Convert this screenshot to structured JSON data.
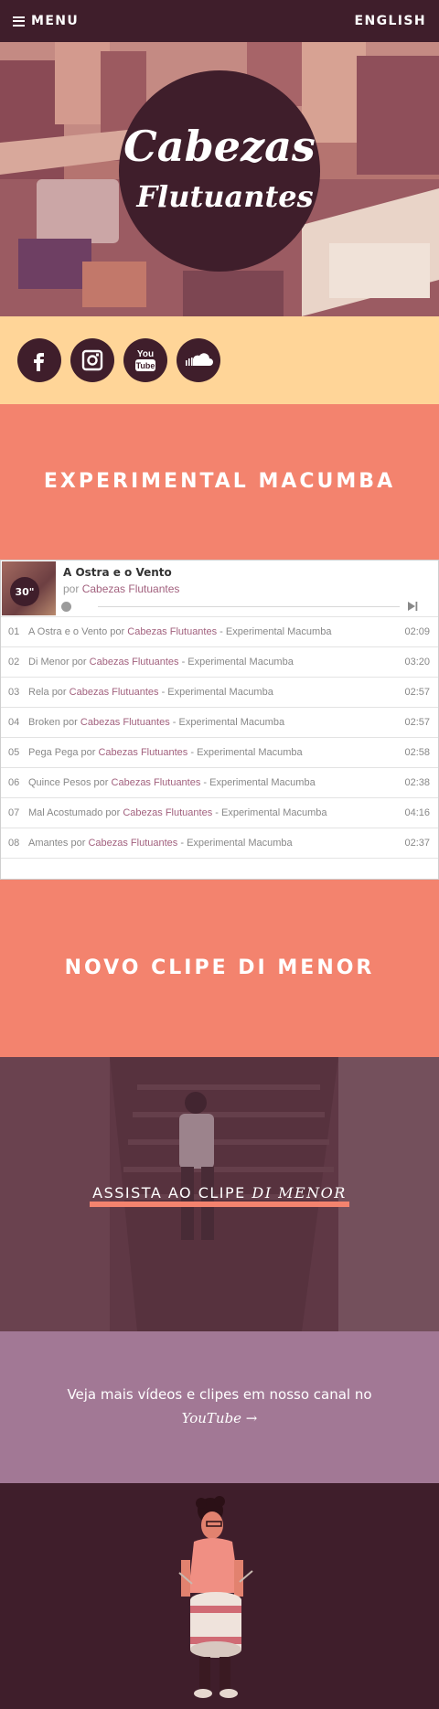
{
  "nav": {
    "menu_label": "MENU",
    "language_label": "ENGLISH"
  },
  "hero": {
    "logo_line1": "Cabezas",
    "logo_line2": "Flutuantes"
  },
  "social": [
    {
      "icon": "facebook-icon"
    },
    {
      "icon": "instagram-icon"
    },
    {
      "icon": "youtube-icon",
      "text": "You Tube"
    },
    {
      "icon": "soundcloud-icon"
    }
  ],
  "album": {
    "title": "EXPERIMENTAL MACUMBA",
    "player": {
      "cover_badge": "30\"",
      "now_title": "A Ostra e o Vento",
      "now_by": "por",
      "now_artist": "Cabezas Flutuantes",
      "tracks": [
        {
          "no": "01",
          "title": "A Ostra e o Vento",
          "by": "por",
          "artist": "Cabezas Flutuantes",
          "album": "- Experimental Macumba",
          "duration": "02:09"
        },
        {
          "no": "02",
          "title": "Di Menor",
          "by": "por",
          "artist": "Cabezas Flutuantes",
          "album": "- Experimental Macumba",
          "duration": "03:20"
        },
        {
          "no": "03",
          "title": "Rela",
          "by": "por",
          "artist": "Cabezas Flutuantes",
          "album": "- Experimental Macumba",
          "duration": "02:57"
        },
        {
          "no": "04",
          "title": "Broken",
          "by": "por",
          "artist": "Cabezas Flutuantes",
          "album": "- Experimental Macumba",
          "duration": "02:57"
        },
        {
          "no": "05",
          "title": "Pega Pega",
          "by": "por",
          "artist": "Cabezas Flutuantes",
          "album": "- Experimental Macumba",
          "duration": "02:58"
        },
        {
          "no": "06",
          "title": "Quince Pesos",
          "by": "por",
          "artist": "Cabezas Flutuantes",
          "album": "- Experimental Macumba",
          "duration": "02:38"
        },
        {
          "no": "07",
          "title": "Mal Acostumado",
          "by": "por",
          "artist": "Cabezas Flutuantes",
          "album": "- Experimental Macumba",
          "duration": "04:16"
        },
        {
          "no": "08",
          "title": "Amantes",
          "by": "por",
          "artist": "Cabezas Flutuantes",
          "album": "- Experimental Macumba",
          "duration": "02:37"
        }
      ]
    }
  },
  "video": {
    "title": "NOVO CLIPE DI MENOR",
    "cta_prefix": "ASSISTA AO CLIPE",
    "cta_em": "DI MENOR"
  },
  "youtube": {
    "line1": "Veja mais vídeos e clipes em nosso canal no",
    "link": "YouTube →"
  },
  "colors": {
    "dark": "#3f1e2b",
    "salmon": "#f3836e",
    "peach": "#ffd598",
    "mauve": "#a27895",
    "link": "#a2617e"
  }
}
